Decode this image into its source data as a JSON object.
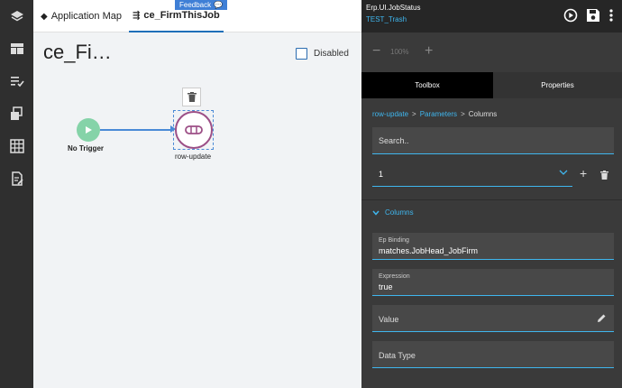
{
  "rail": {
    "items": [
      "layers-icon",
      "dashboard-icon",
      "checklist-icon",
      "transfer-icon",
      "table-icon",
      "document-edit-icon"
    ]
  },
  "tabs": [
    {
      "label": "Application Map",
      "icon": "layers-icon"
    },
    {
      "label": "ce_FirmThisJob",
      "icon": "workflow-icon"
    }
  ],
  "feedback": {
    "label": "Feedback"
  },
  "canvas": {
    "title": "ce_Fi…",
    "disabled_label": "Disabled",
    "trigger_label": "No Trigger",
    "action_label": "row-update"
  },
  "header": {
    "app": "Erp.UI.JobStatus",
    "subtitle": "TEST_Trash"
  },
  "zoom": {
    "minus": "−",
    "value": "100%",
    "plus": "+"
  },
  "panel_tabs": [
    "Toolbox",
    "Properties"
  ],
  "breadcrumb": {
    "items": [
      "row-update",
      "Parameters",
      "Columns"
    ],
    "sep": ">"
  },
  "search": {
    "placeholder": "Search.."
  },
  "row_select": {
    "value": "1",
    "add": "+"
  },
  "section": {
    "label": "Columns"
  },
  "fields": {
    "binding": {
      "label": "Ep Binding",
      "value": "matches.JobHead_JobFirm"
    },
    "expression": {
      "label": "Expression",
      "value": "true"
    },
    "value": {
      "label": "Value"
    },
    "datatype": {
      "label": "Data Type"
    }
  },
  "colors": {
    "accent": "#3fb6ee",
    "node_border": "#9c4f86",
    "trigger": "#85d3a8"
  }
}
